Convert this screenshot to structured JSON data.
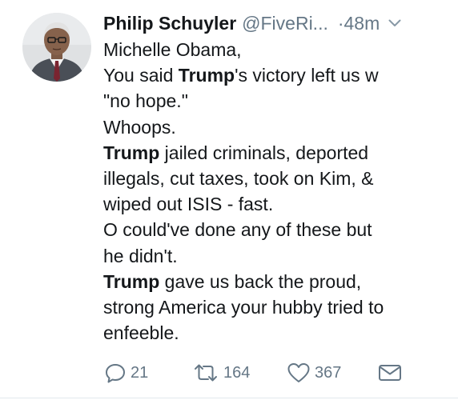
{
  "tweet": {
    "author_name": "Philip Schuyler",
    "author_handle": "@FiveRi...",
    "time": "·48m",
    "lines": [
      [
        "Michelle Obama,"
      ],
      [
        "You said ",
        {
          "b": "Trump"
        },
        "'s victory left us w"
      ],
      [
        "\"no hope.\""
      ],
      [
        "Whoops."
      ],
      [
        {
          "b": "Trump"
        },
        " jailed criminals, deported"
      ],
      [
        "illegals, cut taxes, took on Kim, &"
      ],
      [
        "wiped out ISIS - fast."
      ],
      [
        "O could've done any of these but"
      ],
      [
        "he didn't."
      ],
      [
        {
          "b": "Trump"
        },
        " gave us back the proud,"
      ],
      [
        "strong America your hubby tried to"
      ],
      [
        "enfeeble."
      ]
    ]
  },
  "actions": {
    "reply": {
      "icon": "reply-icon",
      "count": "21"
    },
    "retweet": {
      "icon": "retweet-icon",
      "count": "164"
    },
    "like": {
      "icon": "heart-icon",
      "count": "367"
    },
    "message": {
      "icon": "envelope-icon"
    }
  },
  "colors": {
    "text": "#14171a",
    "muted": "#657786",
    "divider": "#e1e8ed"
  }
}
